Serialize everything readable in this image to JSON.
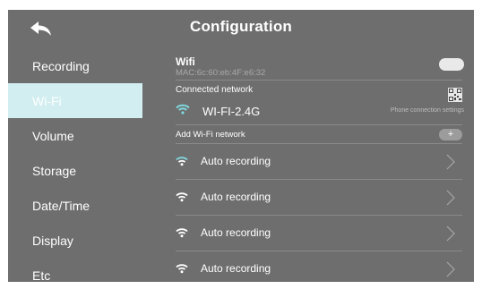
{
  "header": {
    "title": "Configuration",
    "back_icon": "back-arrow-icon"
  },
  "sidebar": {
    "items": [
      {
        "label": "Recording",
        "active": false
      },
      {
        "label": "Wi-Fi",
        "active": true
      },
      {
        "label": "Volume",
        "active": false
      },
      {
        "label": "Storage",
        "active": false
      },
      {
        "label": "Date/Time",
        "active": false
      },
      {
        "label": "Display",
        "active": false
      },
      {
        "label": "Etc",
        "active": false
      }
    ]
  },
  "wifi": {
    "label": "Wifi",
    "mac": "MAC:6c:60:eb:4F:e6:32",
    "toggle_on": true
  },
  "connected": {
    "label": "Connected network",
    "network": "WI-FI-2.4G",
    "phone_settings": "Phone connection settings"
  },
  "add_network": {
    "label": "Add  Wi-Fi network",
    "button": "+"
  },
  "networks": [
    {
      "name": "Auto recording"
    },
    {
      "name": "Auto recording"
    },
    {
      "name": "Auto recording"
    },
    {
      "name": "Auto recording"
    }
  ],
  "colors": {
    "screen_bg": "#6e6e6e",
    "active_item_bg": "#d2eef0",
    "wifi_icon": "#7fd8de",
    "toggle": "#e9e9e9"
  }
}
